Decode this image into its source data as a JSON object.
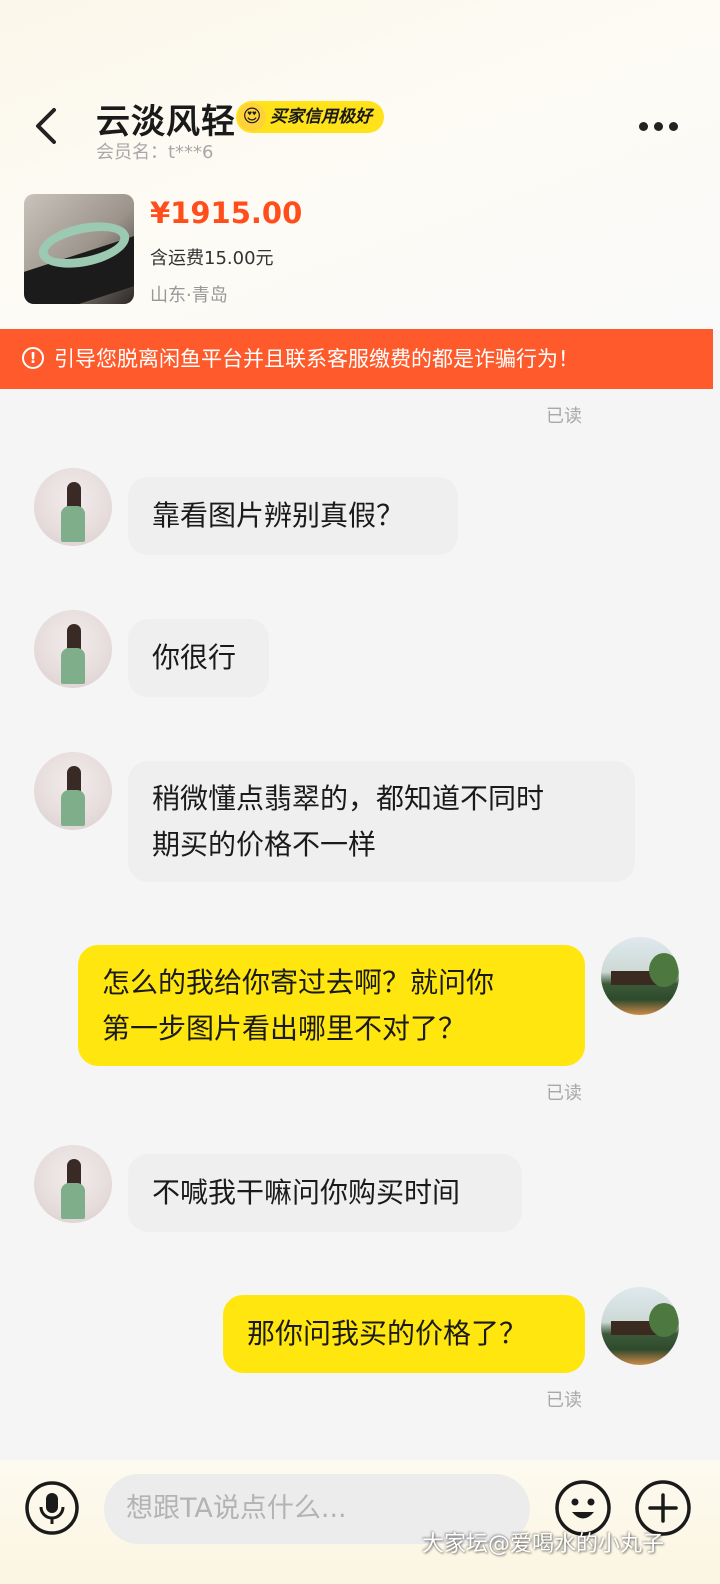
{
  "header": {
    "title": "云淡风轻",
    "badge_label": "买家信用极好",
    "member_label": "会员名：t***6"
  },
  "product": {
    "price": "¥1915.00",
    "shipping": "含运费15.00元",
    "location": "山东·青岛"
  },
  "warning": {
    "text": "引导您脱离闲鱼平台并且联系客服缴费的都是诈骗行为！"
  },
  "messages": [
    {
      "from": "other",
      "text": "靠看图片辨别真假？"
    },
    {
      "from": "other",
      "text": "你很行"
    },
    {
      "from": "other",
      "line1": "稍微懂点翡翠的，都知道不同时",
      "line2": "期买的价格不一样"
    },
    {
      "from": "self",
      "line1": "怎么的我给你寄过去啊？就问你",
      "line2": "第一步图片看出哪里不对了？",
      "status": "已读"
    },
    {
      "from": "other",
      "text": "不喊我干嘛问你购买时间"
    },
    {
      "from": "self",
      "text": "那你问我买的价格了？",
      "status": "已读"
    }
  ],
  "read_top": "已读",
  "input": {
    "placeholder": "想跟TA说点什么..."
  },
  "watermark": "大家坛@爱喝水的小丸子",
  "colors": {
    "accent_orange": "#ff5a2b",
    "price_red": "#ff4e1c",
    "self_bubble": "#ffe60f",
    "other_bubble": "#efefef"
  },
  "icons": [
    "back-arrow-icon",
    "more-icon",
    "warning-icon",
    "microphone-icon",
    "emoji-icon",
    "plus-icon"
  ]
}
